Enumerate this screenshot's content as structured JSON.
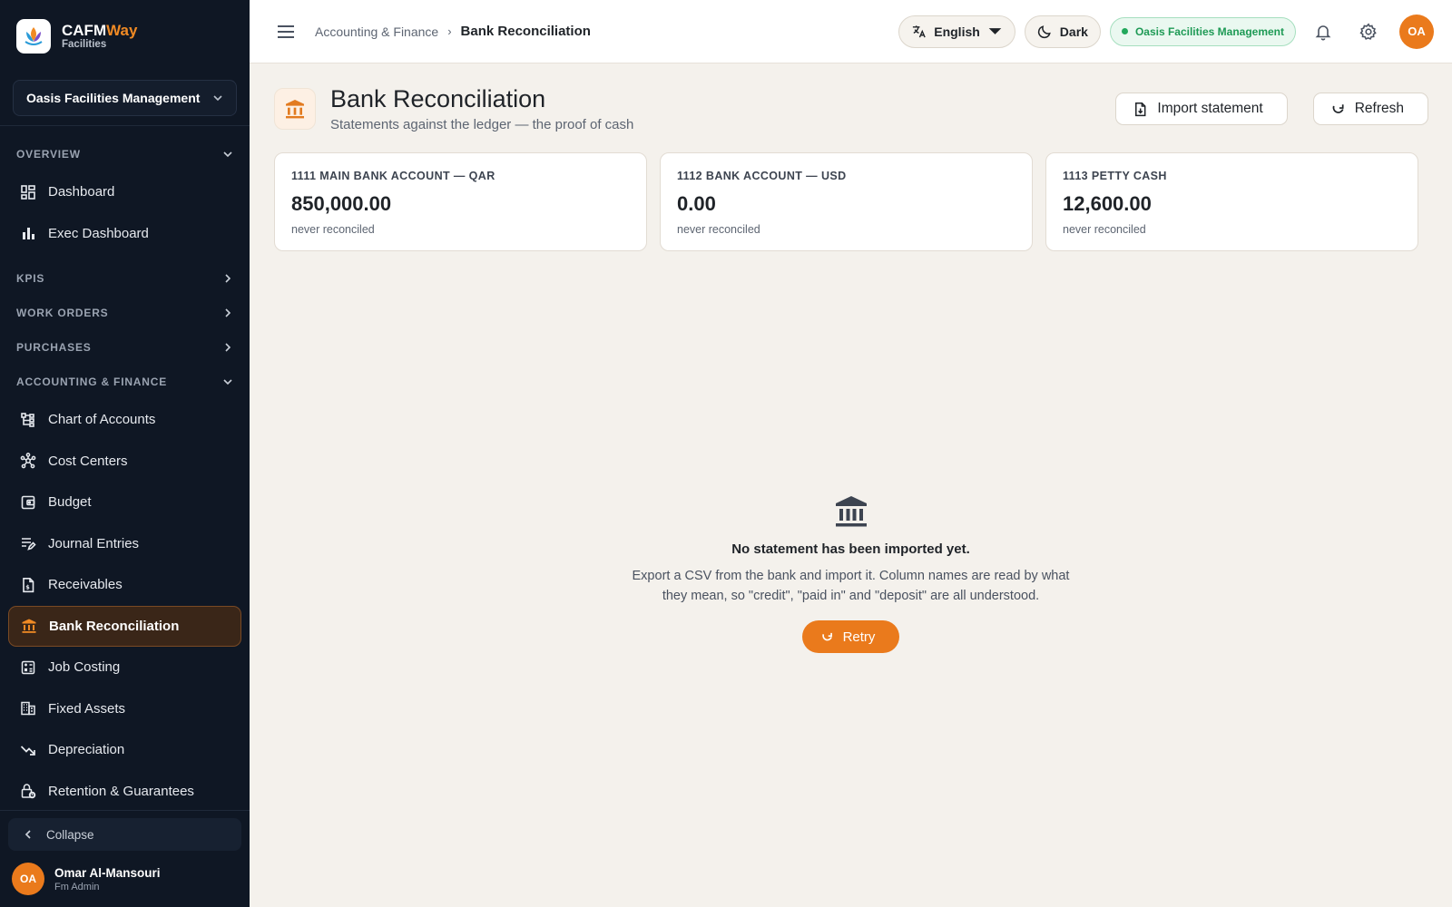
{
  "brand": {
    "name_main": "CAFM",
    "name_accent": "Way",
    "sub": "Facilities"
  },
  "sidebar": {
    "org": "Oasis Facilities Management",
    "sections": {
      "overview": "OVERVIEW",
      "kpis": "KPIS",
      "work_orders": "WORK ORDERS",
      "purchases": "PURCHASES",
      "accounting": "ACCOUNTING & FINANCE"
    },
    "items": {
      "dashboard": "Dashboard",
      "exec_dashboard": "Exec Dashboard",
      "chart_of_accounts": "Chart of Accounts",
      "cost_centers": "Cost Centers",
      "budget": "Budget",
      "journal_entries": "Journal Entries",
      "receivables": "Receivables",
      "bank_reconciliation": "Bank Reconciliation",
      "job_costing": "Job Costing",
      "fixed_assets": "Fixed Assets",
      "depreciation": "Depreciation",
      "retention": "Retention & Guarantees"
    },
    "collapse": "Collapse",
    "user": {
      "initials": "OA",
      "name": "Omar Al-Mansouri",
      "role": "Fm Admin"
    }
  },
  "topbar": {
    "breadcrumb_parent": "Accounting & Finance",
    "breadcrumb_sep": "›",
    "breadcrumb_current": "Bank Reconciliation",
    "language": "English",
    "theme": "Dark",
    "org_badge": "Oasis Facilities Management",
    "avatar": "OA"
  },
  "page": {
    "title": "Bank Reconciliation",
    "subtitle": "Statements against the ledger — the proof of cash",
    "import_label": "Import statement",
    "refresh_label": "Refresh"
  },
  "accounts": [
    {
      "label": "1111 MAIN BANK ACCOUNT — QAR",
      "balance": "850,000.00",
      "status": "never reconciled"
    },
    {
      "label": "1112 BANK ACCOUNT — USD",
      "balance": "0.00",
      "status": "never reconciled"
    },
    {
      "label": "1113 PETTY CASH",
      "balance": "12,600.00",
      "status": "never reconciled"
    }
  ],
  "empty_state": {
    "title": "No statement has been imported yet.",
    "text": "Export a CSV from the bank and import it. Column names are read by what they mean, so \"credit\", \"paid in\" and \"deposit\" are all understood.",
    "retry": "Retry"
  },
  "colors": {
    "accent": "#ea7a1c",
    "sidebar_bg": "#0f1724",
    "success": "#1e9a55"
  },
  "icons": {
    "dashboard": "grid-icon",
    "exec_dashboard": "bar-chart-icon",
    "chart_of_accounts": "tree-icon",
    "cost_centers": "hub-icon",
    "budget": "wallet-icon",
    "journal_entries": "edit-list-icon",
    "receivables": "invoice-icon",
    "bank_reconciliation": "bank-icon",
    "job_costing": "calculator-icon",
    "fixed_assets": "building-icon",
    "depreciation": "trending-down-icon",
    "retention": "lock-shield-icon"
  }
}
